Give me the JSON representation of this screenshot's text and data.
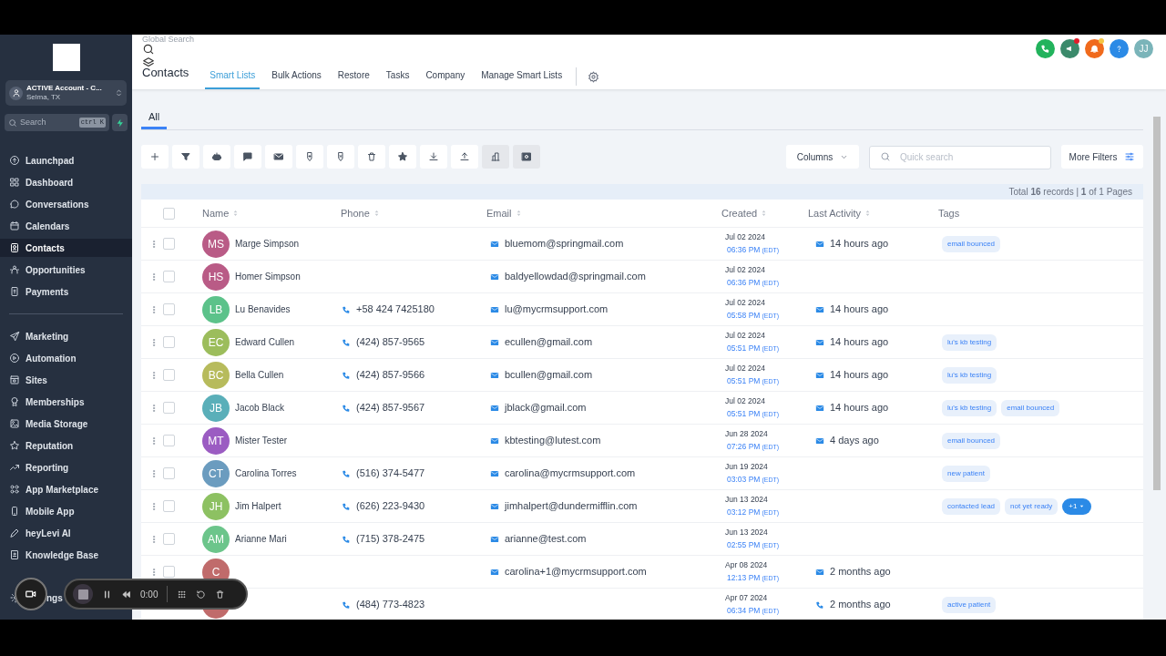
{
  "sidebar": {
    "account": {
      "name": "ACTIVE Account - C...",
      "location": "Selma, TX"
    },
    "search": {
      "placeholder": "Search",
      "shortcut": "ctrl K"
    },
    "groups": [
      [
        {
          "label": "Launchpad",
          "selected": false
        },
        {
          "label": "Dashboard",
          "selected": false
        },
        {
          "label": "Conversations",
          "selected": false
        },
        {
          "label": "Calendars",
          "selected": false
        },
        {
          "label": "Contacts",
          "selected": true
        },
        {
          "label": "Opportunities",
          "selected": false
        },
        {
          "label": "Payments",
          "selected": false
        }
      ],
      [
        {
          "label": "Marketing",
          "selected": false
        },
        {
          "label": "Automation",
          "selected": false
        },
        {
          "label": "Sites",
          "selected": false
        },
        {
          "label": "Memberships",
          "selected": false
        },
        {
          "label": "Media Storage",
          "selected": false
        },
        {
          "label": "Reputation",
          "selected": false
        },
        {
          "label": "Reporting",
          "selected": false
        },
        {
          "label": "App Marketplace",
          "selected": false
        },
        {
          "label": "Mobile App",
          "selected": false
        },
        {
          "label": "heyLevi AI",
          "selected": false
        },
        {
          "label": "Knowledge Base",
          "selected": false
        }
      ]
    ],
    "settings_label": "ngs"
  },
  "header": {
    "global_search_label": "Global Search",
    "title": "Contacts",
    "tabs": [
      {
        "label": "Smart Lists",
        "selected": true
      },
      {
        "label": "Bulk Actions",
        "selected": false
      },
      {
        "label": "Restore",
        "selected": false
      },
      {
        "label": "Tasks",
        "selected": false
      },
      {
        "label": "Company",
        "selected": false
      },
      {
        "label": "Manage Smart Lists",
        "selected": false
      }
    ],
    "avatar": "JJ"
  },
  "list_tabs": [
    {
      "label": "All",
      "selected": true
    }
  ],
  "controls": {
    "columns": "Columns",
    "quick_search_placeholder": "Quick search",
    "more_filters": "More Filters",
    "summary": "Total **16** records | **1** of 1 Pages"
  },
  "table": {
    "select_all_checked": false,
    "columns": [
      "Name",
      "Phone",
      "Email",
      "Created",
      "Last Activity",
      "Tags"
    ],
    "rows": [
      {
        "checked": false,
        "initials": "MS",
        "color": "#b95b86",
        "name": "Marge Simpson",
        "phone": "",
        "email": "bluemom@springmail.com",
        "date": "Jul 02 2024",
        "time": "06:36 PM",
        "tz": "(EDT)",
        "activity": {
          "kind": "email",
          "text": "14 hours ago"
        },
        "tags": [
          "email bounced"
        ]
      },
      {
        "checked": false,
        "initials": "HS",
        "color": "#b95b86",
        "name": "Homer Simpson",
        "phone": "",
        "email": "baldyellowdad@springmail.com",
        "date": "Jul 02 2024",
        "time": "06:36 PM",
        "tz": "(EDT)",
        "tags": []
      },
      {
        "checked": false,
        "initials": "LB",
        "color": "#5cc28a",
        "name": "Lu Benavides",
        "phone": "+58 424 7425180",
        "email": "lu@mycrmsupport.com",
        "date": "Jul 02 2024",
        "time": "05:58 PM",
        "tz": "(EDT)",
        "activity": {
          "kind": "email",
          "text": "14 hours ago"
        },
        "tags": []
      },
      {
        "checked": false,
        "initials": "EC",
        "color": "#9cbd5c",
        "name": "Edward Cullen",
        "phone": "(424) 857-9565",
        "email": "ecullen@gmail.com",
        "date": "Jul 02 2024",
        "time": "05:51 PM",
        "tz": "(EDT)",
        "activity": {
          "kind": "email",
          "text": "14 hours ago"
        },
        "tags": [
          "lu's kb testing"
        ]
      },
      {
        "checked": false,
        "initials": "BC",
        "color": "#b7bb5c",
        "name": "Bella Cullen",
        "phone": "(424) 857-9566",
        "email": "bcullen@gmail.com",
        "date": "Jul 02 2024",
        "time": "05:51 PM",
        "tz": "(EDT)",
        "activity": {
          "kind": "email",
          "text": "14 hours ago"
        },
        "tags": [
          "lu's kb testing"
        ]
      },
      {
        "checked": false,
        "initials": "JB",
        "color": "#5aafb9",
        "name": "Jacob Black",
        "phone": "(424) 857-9567",
        "email": "jblack@gmail.com",
        "date": "Jul 02 2024",
        "time": "05:51 PM",
        "tz": "(EDT)",
        "activity": {
          "kind": "email",
          "text": "14 hours ago"
        },
        "tags": [
          "lu's kb testing",
          "email bounced"
        ]
      },
      {
        "checked": false,
        "initials": "MT",
        "color": "#9b5cc2",
        "name": "Mister Tester",
        "phone": "",
        "email": "kbtesting@lutest.com",
        "date": "Jun 28 2024",
        "time": "07:26 PM",
        "tz": "(EDT)",
        "activity": {
          "kind": "email",
          "text": "4 days ago"
        },
        "tags": [
          "email bounced"
        ]
      },
      {
        "checked": false,
        "initials": "CT",
        "color": "#6b9cbf",
        "name": "Carolina Torres",
        "phone": "(516) 374-5477",
        "email": "carolina@mycrmsupport.com",
        "date": "Jun 19 2024",
        "time": "03:03 PM",
        "tz": "(EDT)",
        "tags": [
          "new patient"
        ]
      },
      {
        "checked": false,
        "initials": "JH",
        "color": "#8dc162",
        "name": "Jim Halpert",
        "phone": "(626) 223-9430",
        "email": "jimhalpert@dundermifflin.com",
        "date": "Jun 13 2024",
        "time": "03:12 PM",
        "tz": "(EDT)",
        "tags": [
          "contacted lead",
          "not yet ready"
        ],
        "more_tags": "+1"
      },
      {
        "checked": false,
        "initials": "AM",
        "color": "#6cc58b",
        "name": "Arianne Mari",
        "phone": "(715) 378-2475",
        "email": "arianne@test.com",
        "date": "Jun 13 2024",
        "time": "02:55 PM",
        "tz": "(EDT)",
        "tags": []
      },
      {
        "checked": false,
        "initials": "C",
        "color": "#c06b6b",
        "name": "",
        "phone": "",
        "email": "carolina+1@mycrmsupport.com",
        "date": "Apr 08 2024",
        "time": "12:13 PM",
        "tz": "(EDT)",
        "activity": {
          "kind": "email",
          "text": "2 months ago"
        },
        "tags": []
      },
      {
        "initials": "",
        "color": "#c06b6b",
        "name": "",
        "phone": "(484) 773-4823",
        "email": "",
        "date": "Apr 07 2024",
        "time": "06:34 PM",
        "tz": "(EDT)",
        "activity": {
          "kind": "call",
          "text": "2 months ago"
        },
        "tags": [
          "active patient"
        ]
      }
    ]
  },
  "recorder": {
    "time": "0:00"
  }
}
